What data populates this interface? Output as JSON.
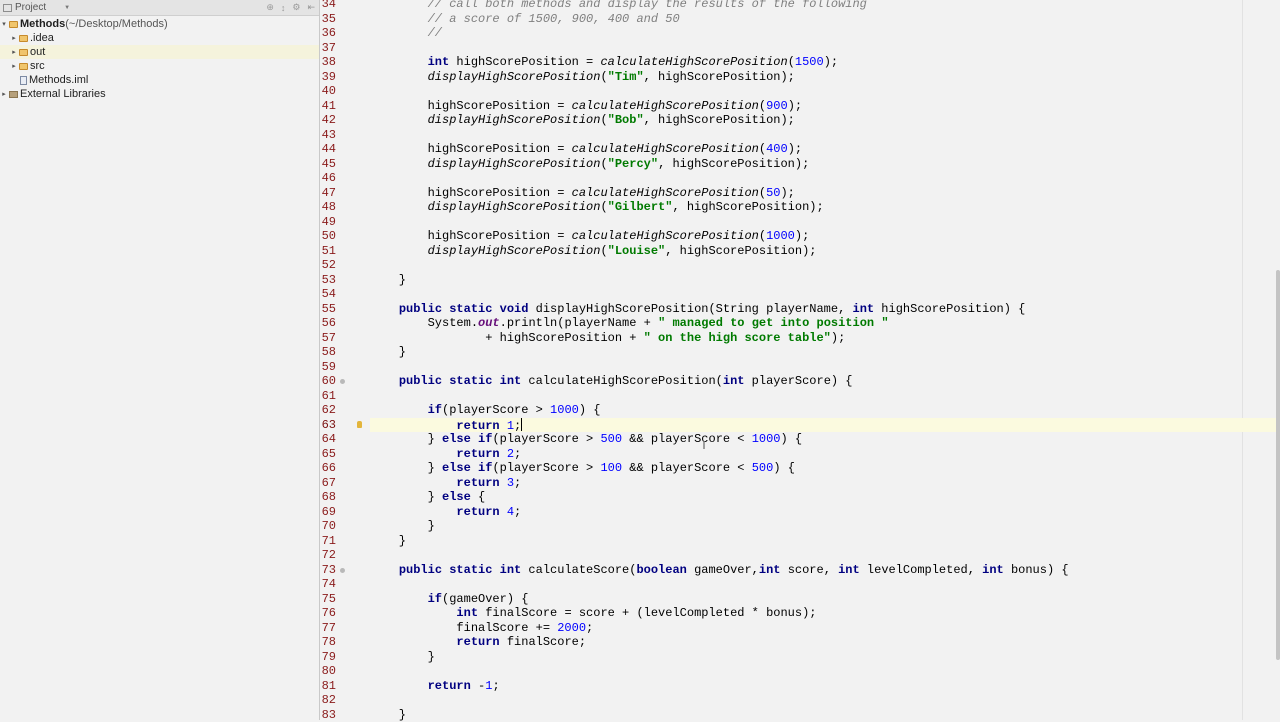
{
  "project_panel": {
    "title": "Project",
    "tree": [
      {
        "label": "Methods",
        "suffix": " (~/Desktop/Methods)",
        "type": "root",
        "expanded": true
      },
      {
        "label": ".idea",
        "type": "folder",
        "expanded": false
      },
      {
        "label": "out",
        "type": "folder",
        "expanded": false,
        "selected": true
      },
      {
        "label": "src",
        "type": "folder",
        "expanded": false
      },
      {
        "label": "Methods.iml",
        "type": "file"
      },
      {
        "label": "External Libraries",
        "type": "library",
        "expanded": false
      }
    ]
  },
  "editor": {
    "current_line": 63,
    "lines": [
      {
        "n": 34,
        "segs": [
          [
            "cmt",
            "        // call both methods and display the results of the following"
          ]
        ]
      },
      {
        "n": 35,
        "segs": [
          [
            "cmt",
            "        // a score of 1500, 900, 400 and 50"
          ]
        ]
      },
      {
        "n": 36,
        "segs": [
          [
            "cmt",
            "        //"
          ]
        ]
      },
      {
        "n": 37,
        "segs": []
      },
      {
        "n": 38,
        "segs": [
          [
            "",
            "        "
          ],
          [
            "kw",
            "int"
          ],
          [
            "",
            " highScorePosition = "
          ],
          [
            "it",
            "calculateHighScorePosition"
          ],
          [
            "",
            "("
          ],
          [
            "num",
            "1500"
          ],
          [
            "",
            ");"
          ]
        ]
      },
      {
        "n": 39,
        "segs": [
          [
            "",
            "        "
          ],
          [
            "it",
            "displayHighScorePosition"
          ],
          [
            "",
            "("
          ],
          [
            "str",
            "\"Tim\""
          ],
          [
            "",
            ", highScorePosition);"
          ]
        ]
      },
      {
        "n": 40,
        "segs": []
      },
      {
        "n": 41,
        "segs": [
          [
            "",
            "        highScorePosition = "
          ],
          [
            "it",
            "calculateHighScorePosition"
          ],
          [
            "",
            "("
          ],
          [
            "num",
            "900"
          ],
          [
            "",
            ");"
          ]
        ]
      },
      {
        "n": 42,
        "segs": [
          [
            "",
            "        "
          ],
          [
            "it",
            "displayHighScorePosition"
          ],
          [
            "",
            "("
          ],
          [
            "str",
            "\"Bob\""
          ],
          [
            "",
            ", highScorePosition);"
          ]
        ]
      },
      {
        "n": 43,
        "segs": []
      },
      {
        "n": 44,
        "segs": [
          [
            "",
            "        highScorePosition = "
          ],
          [
            "it",
            "calculateHighScorePosition"
          ],
          [
            "",
            "("
          ],
          [
            "num",
            "400"
          ],
          [
            "",
            ");"
          ]
        ]
      },
      {
        "n": 45,
        "segs": [
          [
            "",
            "        "
          ],
          [
            "it",
            "displayHighScorePosition"
          ],
          [
            "",
            "("
          ],
          [
            "str",
            "\"Percy\""
          ],
          [
            "",
            ", highScorePosition);"
          ]
        ]
      },
      {
        "n": 46,
        "segs": []
      },
      {
        "n": 47,
        "segs": [
          [
            "",
            "        highScorePosition = "
          ],
          [
            "it",
            "calculateHighScorePosition"
          ],
          [
            "",
            "("
          ],
          [
            "num",
            "50"
          ],
          [
            "",
            ");"
          ]
        ]
      },
      {
        "n": 48,
        "segs": [
          [
            "",
            "        "
          ],
          [
            "it",
            "displayHighScorePosition"
          ],
          [
            "",
            "("
          ],
          [
            "str",
            "\"Gilbert\""
          ],
          [
            "",
            ", highScorePosition);"
          ]
        ]
      },
      {
        "n": 49,
        "segs": []
      },
      {
        "n": 50,
        "segs": [
          [
            "",
            "        highScorePosition = "
          ],
          [
            "it",
            "calculateHighScorePosition"
          ],
          [
            "",
            "("
          ],
          [
            "num",
            "1000"
          ],
          [
            "",
            ");"
          ]
        ]
      },
      {
        "n": 51,
        "segs": [
          [
            "",
            "        "
          ],
          [
            "it",
            "displayHighScorePosition"
          ],
          [
            "",
            "("
          ],
          [
            "str",
            "\"Louise\""
          ],
          [
            "",
            ", highScorePosition);"
          ]
        ]
      },
      {
        "n": 52,
        "segs": []
      },
      {
        "n": 53,
        "segs": [
          [
            "",
            "    }"
          ]
        ]
      },
      {
        "n": 54,
        "segs": []
      },
      {
        "n": 55,
        "segs": [
          [
            "",
            "    "
          ],
          [
            "kw",
            "public static void"
          ],
          [
            "",
            " displayHighScorePosition(String playerName, "
          ],
          [
            "kw",
            "int"
          ],
          [
            "",
            " highScorePosition) {"
          ]
        ]
      },
      {
        "n": 56,
        "segs": [
          [
            "",
            "        System."
          ],
          [
            "field",
            "out"
          ],
          [
            "",
            ".println(playerName + "
          ],
          [
            "str",
            "\" managed to get into position \""
          ]
        ]
      },
      {
        "n": 57,
        "segs": [
          [
            "",
            "                + highScorePosition + "
          ],
          [
            "str",
            "\" on the high score table\""
          ],
          [
            "",
            ");"
          ]
        ]
      },
      {
        "n": 58,
        "segs": [
          [
            "",
            "    }"
          ]
        ]
      },
      {
        "n": 59,
        "segs": []
      },
      {
        "n": 60,
        "fold": true,
        "segs": [
          [
            "",
            "    "
          ],
          [
            "kw",
            "public static int"
          ],
          [
            "",
            " calculateHighScorePosition("
          ],
          [
            "kw",
            "int"
          ],
          [
            "",
            " playerScore) {"
          ]
        ]
      },
      {
        "n": 61,
        "segs": []
      },
      {
        "n": 62,
        "segs": [
          [
            "",
            "        "
          ],
          [
            "kw",
            "if"
          ],
          [
            "",
            "(playerScore > "
          ],
          [
            "num",
            "1000"
          ],
          [
            "",
            ") {"
          ]
        ]
      },
      {
        "n": 63,
        "bulb": true,
        "caret": true,
        "segs": [
          [
            "",
            "            "
          ],
          [
            "kw",
            "return"
          ],
          [
            "",
            " "
          ],
          [
            "num",
            "1"
          ],
          [
            "",
            ";"
          ]
        ]
      },
      {
        "n": 64,
        "segs": [
          [
            "",
            "        } "
          ],
          [
            "kw",
            "else if"
          ],
          [
            "",
            "(playerScore > "
          ],
          [
            "num",
            "500"
          ],
          [
            "",
            " && playerScore < "
          ],
          [
            "num",
            "1000"
          ],
          [
            "",
            ") {"
          ]
        ]
      },
      {
        "n": 65,
        "segs": [
          [
            "",
            "            "
          ],
          [
            "kw",
            "return"
          ],
          [
            "",
            " "
          ],
          [
            "num",
            "2"
          ],
          [
            "",
            ";"
          ]
        ]
      },
      {
        "n": 66,
        "segs": [
          [
            "",
            "        } "
          ],
          [
            "kw",
            "else if"
          ],
          [
            "",
            "(playerScore > "
          ],
          [
            "num",
            "100"
          ],
          [
            "",
            " && playerScore < "
          ],
          [
            "num",
            "500"
          ],
          [
            "",
            ") {"
          ]
        ]
      },
      {
        "n": 67,
        "segs": [
          [
            "",
            "            "
          ],
          [
            "kw",
            "return"
          ],
          [
            "",
            " "
          ],
          [
            "num",
            "3"
          ],
          [
            "",
            ";"
          ]
        ]
      },
      {
        "n": 68,
        "segs": [
          [
            "",
            "        } "
          ],
          [
            "kw",
            "else"
          ],
          [
            "",
            " {"
          ]
        ]
      },
      {
        "n": 69,
        "segs": [
          [
            "",
            "            "
          ],
          [
            "kw",
            "return"
          ],
          [
            "",
            " "
          ],
          [
            "num",
            "4"
          ],
          [
            "",
            ";"
          ]
        ]
      },
      {
        "n": 70,
        "segs": [
          [
            "",
            "        }"
          ]
        ]
      },
      {
        "n": 71,
        "segs": [
          [
            "",
            "    }"
          ]
        ]
      },
      {
        "n": 72,
        "segs": []
      },
      {
        "n": 73,
        "fold": true,
        "segs": [
          [
            "",
            "    "
          ],
          [
            "kw",
            "public static int"
          ],
          [
            "",
            " calculateScore("
          ],
          [
            "kw",
            "boolean"
          ],
          [
            "",
            " gameOver,"
          ],
          [
            "kw",
            "int"
          ],
          [
            "",
            " score, "
          ],
          [
            "kw",
            "int"
          ],
          [
            "",
            " levelCompleted, "
          ],
          [
            "kw",
            "int"
          ],
          [
            "",
            " bonus) {"
          ]
        ]
      },
      {
        "n": 74,
        "segs": []
      },
      {
        "n": 75,
        "segs": [
          [
            "",
            "        "
          ],
          [
            "kw",
            "if"
          ],
          [
            "",
            "(gameOver) {"
          ]
        ]
      },
      {
        "n": 76,
        "segs": [
          [
            "",
            "            "
          ],
          [
            "kw",
            "int"
          ],
          [
            "",
            " finalScore = score + (levelCompleted * bonus);"
          ]
        ]
      },
      {
        "n": 77,
        "segs": [
          [
            "",
            "            finalScore += "
          ],
          [
            "num",
            "2000"
          ],
          [
            "",
            ";"
          ]
        ]
      },
      {
        "n": 78,
        "segs": [
          [
            "",
            "            "
          ],
          [
            "kw",
            "return"
          ],
          [
            "",
            " finalScore;"
          ]
        ]
      },
      {
        "n": 79,
        "segs": [
          [
            "",
            "        }"
          ]
        ]
      },
      {
        "n": 80,
        "segs": []
      },
      {
        "n": 81,
        "segs": [
          [
            "",
            "        "
          ],
          [
            "kw",
            "return"
          ],
          [
            "",
            " -"
          ],
          [
            "num",
            "1"
          ],
          [
            "",
            ";"
          ]
        ]
      },
      {
        "n": 82,
        "segs": []
      },
      {
        "n": 83,
        "segs": [
          [
            "",
            "    }"
          ]
        ]
      }
    ]
  }
}
